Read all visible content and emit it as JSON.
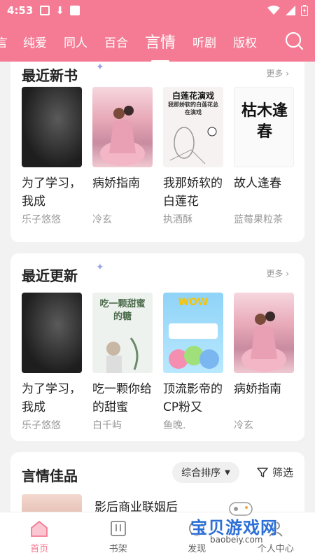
{
  "status": {
    "time": "4:53"
  },
  "tabs": [
    {
      "label": "言"
    },
    {
      "label": "纯爱"
    },
    {
      "label": "同人"
    },
    {
      "label": "百合"
    },
    {
      "label": "言情"
    },
    {
      "label": "听剧"
    },
    {
      "label": "版权"
    }
  ],
  "recent_new": {
    "title": "最近新书",
    "more": "更多 ›",
    "books": [
      {
        "title": "为了学习，我成",
        "author": "乐子悠悠",
        "cover_text": ""
      },
      {
        "title": "病娇指南",
        "author": "冷玄",
        "cover_text": ""
      },
      {
        "title": "我那娇软的白莲花",
        "author": "执酒酥",
        "cover_text": "白莲花演戏",
        "cover_sub": "我那娇软的白莲花总在演戏"
      },
      {
        "title": "故人逢春",
        "author": "蓝莓果粒茶",
        "cover_text": "枯木逢春"
      }
    ]
  },
  "recent_update": {
    "title": "最近更新",
    "more": "更多 ›",
    "books": [
      {
        "title": "为了学习，我成",
        "author": "乐子悠悠",
        "cover_text": ""
      },
      {
        "title": "吃一颗你给的甜蜜",
        "author": "白千屿",
        "cover_text": "吃一颗甜蜜的糖"
      },
      {
        "title": "顶流影帝的CP粉又",
        "author": "鱼晚.",
        "cover_text": "WOW"
      },
      {
        "title": "病娇指南",
        "author": "冷玄",
        "cover_text": ""
      }
    ]
  },
  "featured": {
    "title": "言情佳品",
    "sort_label": "综合排序",
    "filter_label": "筛选",
    "first_book": "影后商业联姻后"
  },
  "bottom_nav": [
    {
      "label": "首页"
    },
    {
      "label": "书架"
    },
    {
      "label": "发现"
    },
    {
      "label": "个人中心"
    }
  ],
  "watermark": {
    "text": "宝贝游戏网",
    "url": "baobeiy.com"
  },
  "colors": {
    "accent": "#f47b93"
  }
}
